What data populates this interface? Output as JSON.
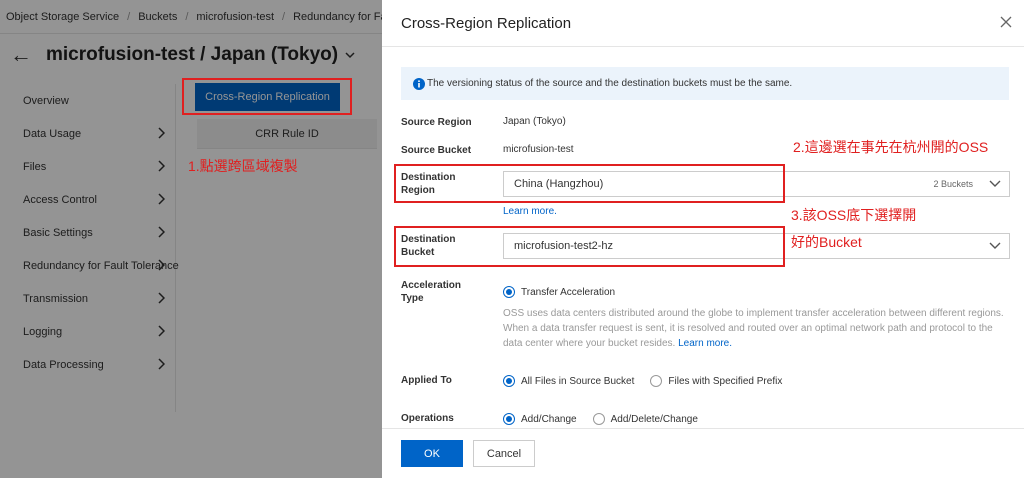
{
  "breadcrumb": [
    "Object Storage Service",
    "Buckets",
    "microfusion-test",
    "Redundancy for Fault Tolera"
  ],
  "page": {
    "title": "microfusion-test / Japan (Tokyo)"
  },
  "sidebar": {
    "items": [
      {
        "label": "Overview"
      },
      {
        "label": "Data Usage"
      },
      {
        "label": "Files"
      },
      {
        "label": "Access Control"
      },
      {
        "label": "Basic Settings"
      },
      {
        "label": "Redundancy for Fault Tolerance"
      },
      {
        "label": "Transmission"
      },
      {
        "label": "Logging"
      },
      {
        "label": "Data Processing"
      }
    ]
  },
  "main": {
    "crr_button_label": "Cross-Region Replication",
    "table_header": "CRR Rule ID"
  },
  "annotations": {
    "note1": "1.點選跨區域複製",
    "note2": "2.這邊選在事先在杭州開的OSS",
    "note3_line1": "3.該OSS底下選擇開",
    "note3_line2": "好的Bucket"
  },
  "drawer": {
    "title": "Cross-Region Replication",
    "notice": "The versioning status of the source and the destination buckets must be the same.",
    "source_region_label": "Source Region",
    "source_region_value": "Japan (Tokyo)",
    "source_bucket_label": "Source Bucket",
    "source_bucket_value": "microfusion-test",
    "dest_region_label_1": "Destination",
    "dest_region_label_2": "Region",
    "dest_region_value": "China (Hangzhou)",
    "dest_region_count": "2 Buckets",
    "learn_more": "Learn more.",
    "dest_bucket_label_1": "Destination",
    "dest_bucket_label_2": "Bucket",
    "dest_bucket_value": "microfusion-test2-hz",
    "accel_label_1": "Acceleration",
    "accel_label_2": "Type",
    "accel_option": "Transfer Acceleration",
    "accel_desc": "OSS uses data centers distributed around the globe to implement transfer acceleration between different regions. When a data transfer request is sent, it is resolved and routed over an optimal network path and protocol to the data center where your bucket resides.",
    "accel_learn_more": "Learn more.",
    "applied_to_label": "Applied To",
    "applied_opt1": "All Files in Source Bucket",
    "applied_opt2": "Files with Specified Prefix",
    "operations_label": "Operations",
    "op_opt1": "Add/Change",
    "op_opt2": "Add/Delete/Change",
    "ok_label": "OK",
    "cancel_label": "Cancel"
  },
  "colors": {
    "primary": "#0064c8",
    "annotation_red": "#e02020",
    "notice_bg": "#ebf3fb"
  }
}
